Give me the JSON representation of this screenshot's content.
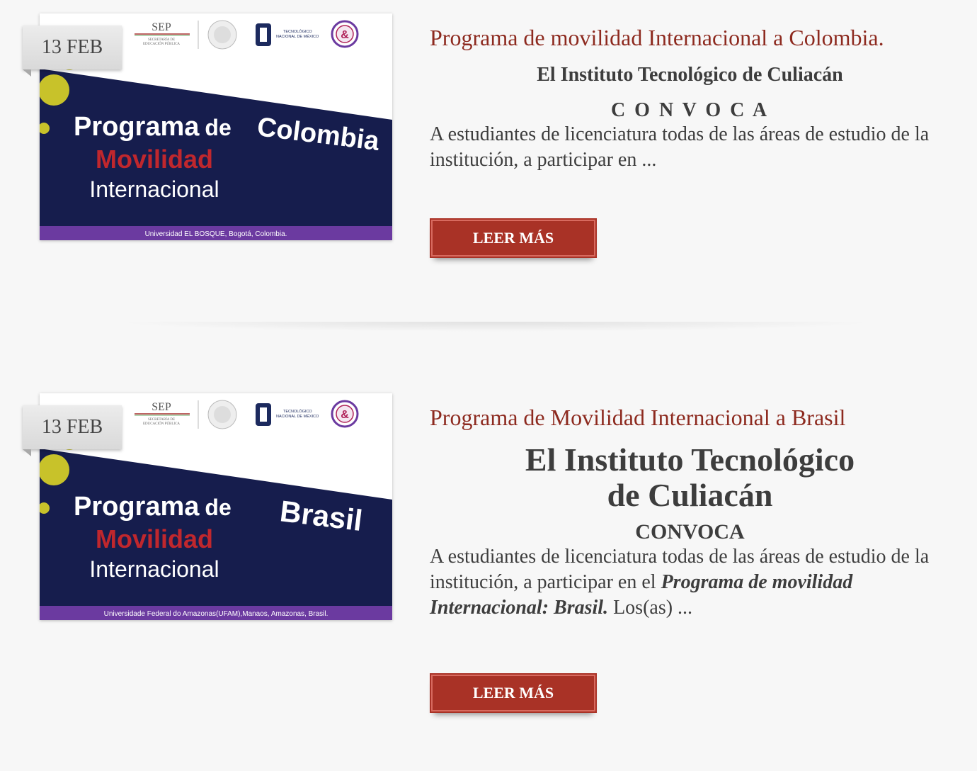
{
  "posts": [
    {
      "date_badge": "13 FEB",
      "title": "Programa de movilidad Internacional a Colombia.",
      "institution": "El Instituto Tecnológico de Culiacán",
      "convoca": "C O N V O C A",
      "excerpt": "A estudiantes de licenciatura todas de las áreas de estudio de la institución, a participar en ...",
      "button_label": "LEER MÁS",
      "image": {
        "country": "Colombia",
        "line1": "Programa",
        "line1b": "de",
        "line2": "Movilidad",
        "line3": "Internacional",
        "footer": "Universidad EL BOSQUE, Bogotá, Colombia.",
        "logo_sep": "SEP",
        "logo_sep_sub1": "SECRETARÍA DE",
        "logo_sep_sub2": "EDUCACIÓN PÚBLICA",
        "logo_tecnm1": "TECNOLÓGICO",
        "logo_tecnm2": "NACIONAL DE MÉXICO"
      }
    },
    {
      "date_badge": "13 FEB",
      "title": "Programa de Movilidad Internacional a Brasil",
      "institution_line1": "El Instituto Tecnológico",
      "institution_line2": "de Culiacán",
      "convoca": "CONVOCA",
      "excerpt_plain": "A estudiantes de licenciatura todas de las áreas de estudio de la institución, a participar en el ",
      "excerpt_emph": "Programa de movilidad Internacional: Brasil.",
      "excerpt_tail": " Los(as) ...",
      "button_label": "LEER MÁS",
      "image": {
        "country": "Brasil",
        "line1": "Programa",
        "line1b": "de",
        "line2": "Movilidad",
        "line3": "Internacional",
        "footer": "Universidade Federal do Amazonas(UFAM),Manaos, Amazonas, Brasil.",
        "logo_sep": "SEP",
        "logo_sep_sub1": "SECRETARÍA DE",
        "logo_sep_sub2": "EDUCACIÓN PÚBLICA",
        "logo_tecnm1": "TECNOLÓGICO",
        "logo_tecnm2": "NACIONAL DE MÉXICO"
      }
    }
  ],
  "colors": {
    "title_red": "#8d2a1f",
    "button_red": "#a93226",
    "banner_navy": "#161d4d",
    "banner_purple": "#6b3aa0",
    "accent_yellow": "#c8c22a",
    "movilidad_red": "#c0272d"
  }
}
